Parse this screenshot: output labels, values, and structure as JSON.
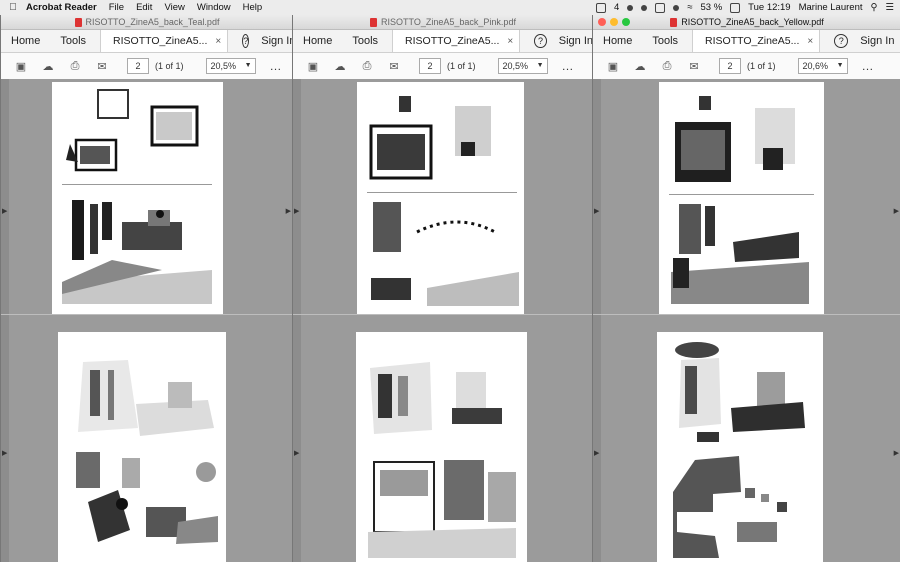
{
  "menubar": {
    "apple": "",
    "items": [
      "Acrobat Reader",
      "File",
      "Edit",
      "View",
      "Window",
      "Help"
    ],
    "status": {
      "badge": "4",
      "battery": "53 %",
      "clock": "Tue 12:19",
      "user": "Marine Laurent"
    }
  },
  "windows": [
    {
      "title": "RISOTTO_ZineA5_back_Teal.pdf",
      "home": "Home",
      "tools": "Tools",
      "tab": "RISOTTO_ZineA5...",
      "signin": "Sign In",
      "page_num": "2",
      "page_of": "(1 of 1)",
      "zoom": "20,5%"
    },
    {
      "title": "RISOTTO_ZineA5_back_Pink.pdf",
      "home": "Home",
      "tools": "Tools",
      "tab": "RISOTTO_ZineA5...",
      "signin": "Sign In",
      "page_num": "2",
      "page_of": "(1 of 1)",
      "zoom": "20,5%"
    },
    {
      "title": "RISOTTO_ZineA5_back_Yellow.pdf",
      "home": "Home",
      "tools": "Tools",
      "tab": "RISOTTO_ZineA5...",
      "signin": "Sign In",
      "page_num": "2",
      "page_of": "(1 of 1)",
      "zoom": "20,6%"
    }
  ],
  "icons": [
    "save-icon",
    "upload-icon",
    "print-icon",
    "mail-icon",
    "help-icon",
    "close-icon",
    "more-icon"
  ],
  "colors": {
    "content_bg": "#9b9b9b",
    "page_bg": "#ffffff",
    "ink": "#1a1a1a"
  }
}
